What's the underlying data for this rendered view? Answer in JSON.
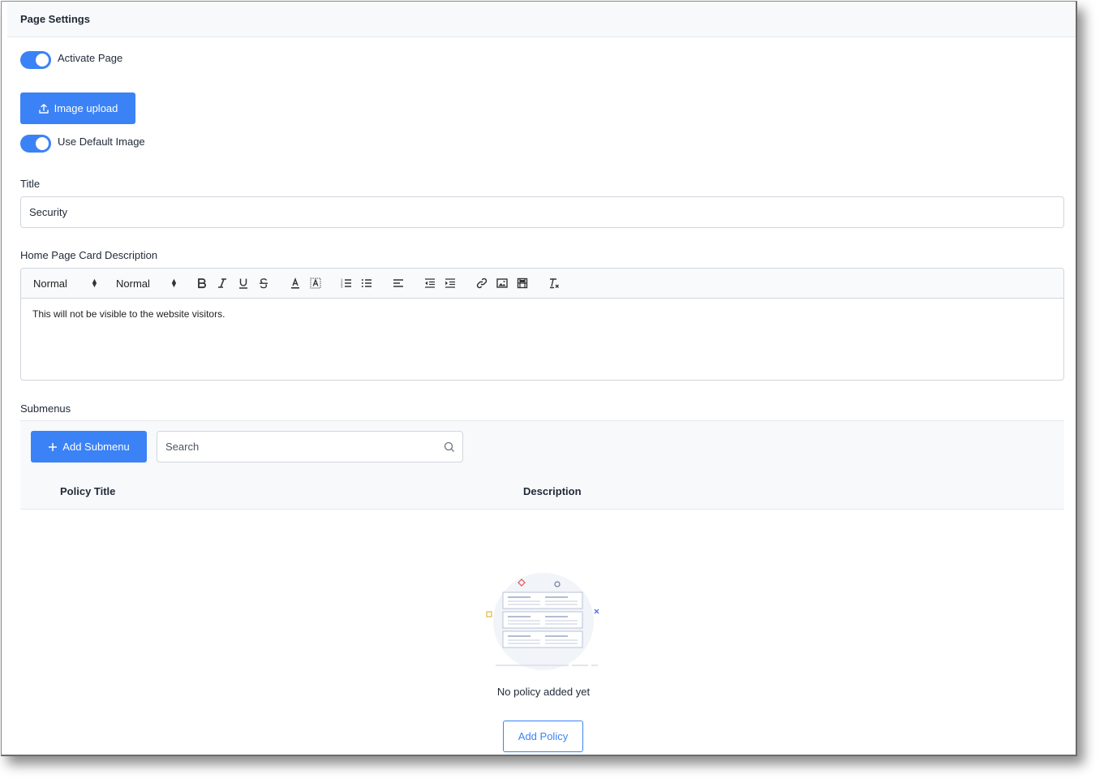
{
  "header": {
    "title": "Page Settings"
  },
  "activate_page": {
    "label": "Activate Page",
    "enabled": true
  },
  "image_upload": {
    "label": "Image upload",
    "icon": "upload-icon"
  },
  "default_image": {
    "label": "Use Default Image",
    "enabled": true
  },
  "title_field": {
    "label": "Title",
    "value": "Security"
  },
  "description_field": {
    "label": "Home Page Card Description",
    "toolbar": {
      "heading_select": "Normal",
      "size_select": "Normal",
      "buttons": [
        "bold-icon",
        "italic-icon",
        "underline-icon",
        "strike-icon",
        "font-color-icon",
        "background-color-icon",
        "ordered-list-icon",
        "bullet-list-icon",
        "align-left-icon",
        "outdent-icon",
        "indent-icon",
        "link-icon",
        "image-icon",
        "video-icon",
        "clear-format-icon"
      ]
    },
    "body": "This will not be visible to the website visitors."
  },
  "submenus": {
    "label": "Submenus",
    "add_button": "Add Submenu",
    "search_placeholder": "Search",
    "columns": [
      "Policy Title",
      "Description"
    ],
    "empty_text": "No policy added yet",
    "add_policy_button": "Add Policy"
  },
  "colors": {
    "accent": "#3b82f6",
    "header_bg": "#f8f9fb",
    "border": "#d1d5db"
  }
}
